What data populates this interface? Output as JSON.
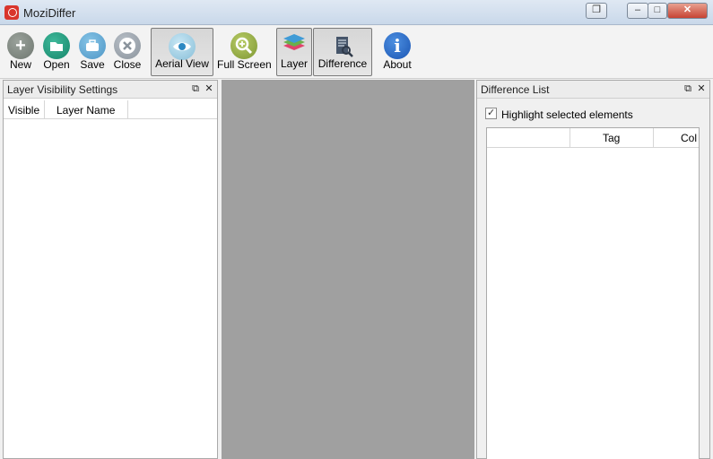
{
  "window": {
    "title": "MoziDiffer"
  },
  "toolbar": {
    "new": "New",
    "open": "Open",
    "save": "Save",
    "close": "Close",
    "aerial_view": "Aerial View",
    "full_screen": "Full Screen",
    "layer": "Layer",
    "difference": "Difference",
    "about": "About"
  },
  "left_panel": {
    "title": "Layer Visibility Settings",
    "columns": [
      "Visible",
      "Layer Name"
    ]
  },
  "right_panel": {
    "title": "Difference List",
    "highlight_label": "Highlight selected elements",
    "columns": [
      "",
      "Tag",
      "Col"
    ]
  },
  "icons": {
    "dock_float": "⧉",
    "dock_close": "✕",
    "min": "–",
    "max": "□",
    "close": "✕",
    "restore": "❐"
  }
}
